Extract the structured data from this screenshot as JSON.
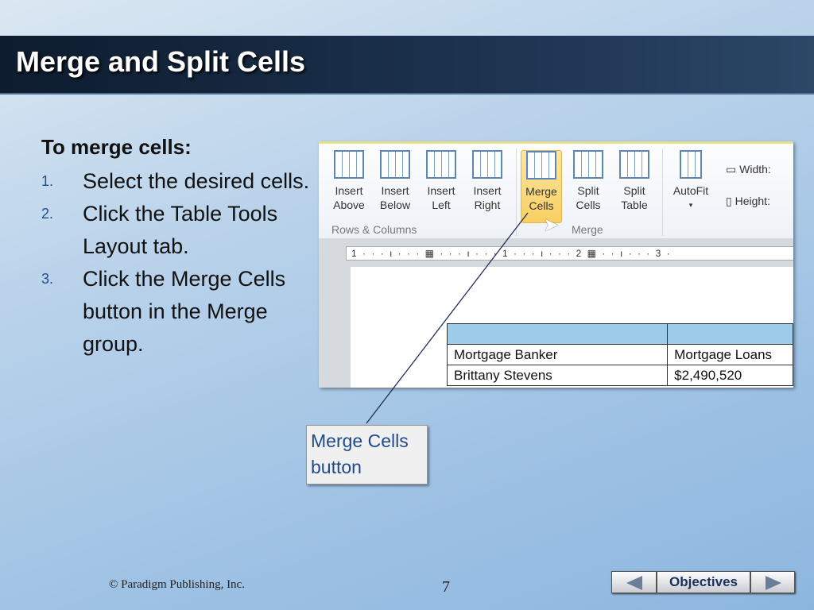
{
  "title": "Merge and Split Cells",
  "instructions": {
    "heading": "To merge cells:",
    "steps": [
      {
        "num": "1.",
        "text": "Select the desired cells."
      },
      {
        "num": "2.",
        "text": "Click the Table Tools Layout tab."
      },
      {
        "num": "3.",
        "text": "Click the Merge Cells button in the Merge group."
      }
    ]
  },
  "ribbon": {
    "buttons": [
      {
        "l1": "Insert",
        "l2": "Above"
      },
      {
        "l1": "Insert",
        "l2": "Below"
      },
      {
        "l1": "Insert",
        "l2": "Left"
      },
      {
        "l1": "Insert",
        "l2": "Right"
      },
      {
        "l1": "Merge",
        "l2": "Cells"
      },
      {
        "l1": "Split",
        "l2": "Cells"
      },
      {
        "l1": "Split",
        "l2": "Table"
      },
      {
        "l1": "AutoFit",
        "l2": "▾"
      }
    ],
    "groups": {
      "rows": "Rows & Columns",
      "merge": "Merge"
    },
    "width_label": "Width:",
    "height_label": "Height:",
    "ruler": "1 · · · ı · · · ▦  · · · ı · · · 1 · · · ı · · · 2 ▦ · · ı · · · 3 ·"
  },
  "table": {
    "rows": [
      [
        "",
        ""
      ],
      [
        "Mortgage Banker",
        "Mortgage Loans"
      ],
      [
        "Brittany Stevens",
        "$2,490,520"
      ]
    ]
  },
  "callout": "Merge Cells button",
  "footer": {
    "copyright": "© Paradigm Publishing, Inc.",
    "page": "7",
    "objectives": "Objectives"
  }
}
